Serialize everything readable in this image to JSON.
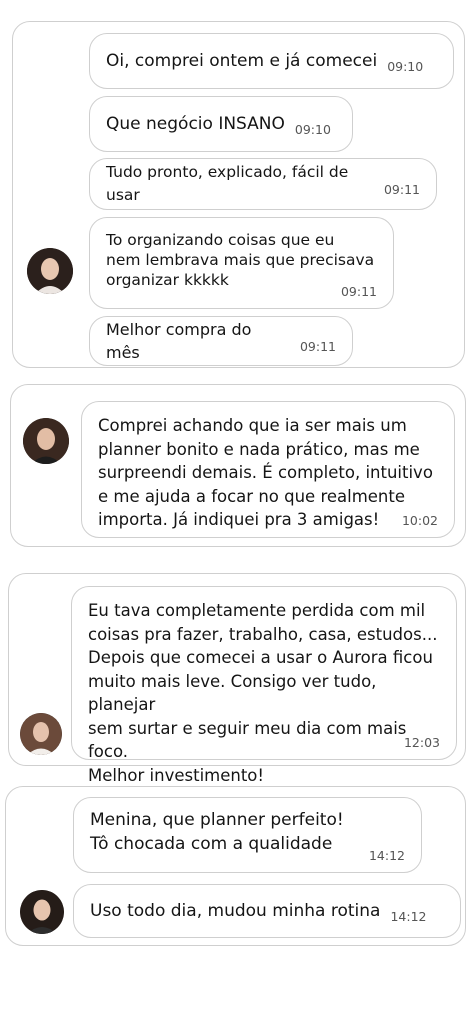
{
  "groups": [
    {
      "messages": [
        {
          "text": "Oi, comprei ontem e já comecei",
          "time": "09:10"
        },
        {
          "text": "Que negócio INSANO",
          "time": "09:10"
        },
        {
          "text": "Tudo pronto, explicado, fácil de usar",
          "time": "09:11"
        },
        {
          "text": "To organizando coisas que eu\nnem lembrava mais que precisava\norganizar kkkkk",
          "time": "09:11"
        },
        {
          "text": "Melhor compra do mês",
          "time": "09:11"
        }
      ]
    },
    {
      "messages": [
        {
          "text": "Comprei achando que ia ser mais um\nplanner bonito e nada prático, mas me\nsurpreendi demais. É completo, intuitivo\ne me ajuda a focar no que realmente\nimporta. Já indiquei pra 3 amigas!",
          "time": "10:02"
        }
      ]
    },
    {
      "messages": [
        {
          "text": "Eu tava completamente perdida com mil\ncoisas pra fazer, trabalho, casa, estudos...\nDepois que comecei a usar o Aurora ficou\nmuito mais leve. Consigo ver tudo, planejar\nsem surtar e seguir meu dia com mais foco.\nMelhor investimento!",
          "time": "12:03"
        }
      ]
    },
    {
      "messages": [
        {
          "text": "Menina, que planner perfeito!\nTô chocada com a qualidade",
          "time": "14:12"
        },
        {
          "text": "Uso todo dia, mudou minha rotina",
          "time": "14:12"
        }
      ]
    }
  ]
}
